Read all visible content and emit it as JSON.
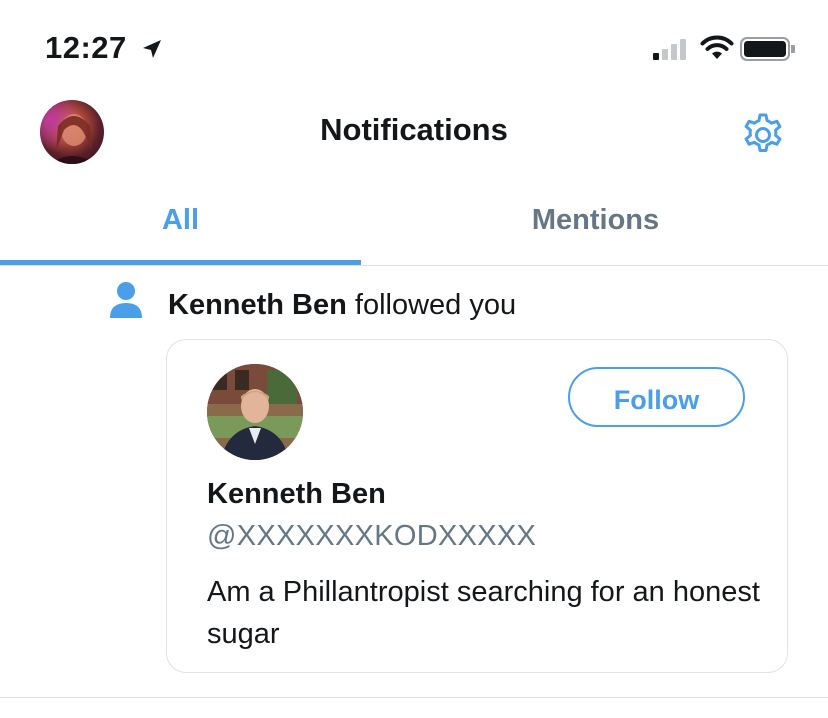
{
  "status_bar": {
    "time": "12:27",
    "icons": [
      "location-arrow-icon",
      "cellular-signal-icon",
      "wifi-icon",
      "battery-icon"
    ]
  },
  "header": {
    "title": "Notifications",
    "left_icon": "profile-avatar",
    "right_icon": "gear-icon"
  },
  "tabs": [
    {
      "label": "All",
      "active": true
    },
    {
      "label": "Mentions",
      "active": false
    }
  ],
  "notification": {
    "icon": "person-icon",
    "actor": "Kenneth Ben",
    "action": "followed you",
    "card": {
      "name": "Kenneth Ben",
      "handle": "@XXXXXXXKODXXXXX",
      "bio": "Am a Phillantropist searching for an honest sugar",
      "follow_label": "Follow"
    }
  },
  "colors": {
    "accent": "#4a9eea",
    "text": "#14171a",
    "muted": "#657786",
    "border": "#dfe3e8"
  }
}
